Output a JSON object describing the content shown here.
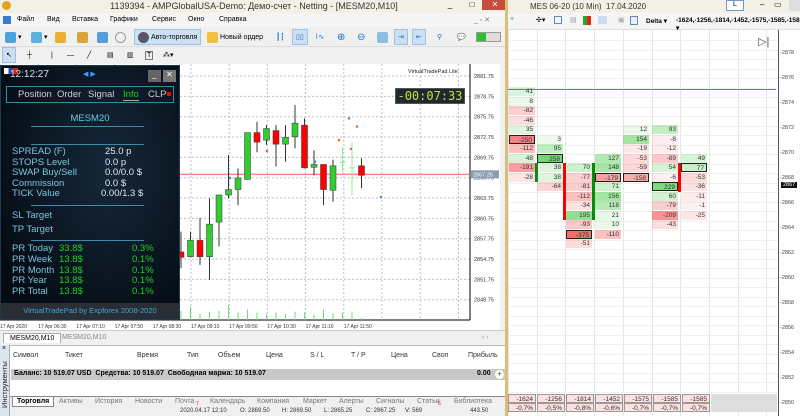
{
  "window": {
    "title": "1139394 - AMPGlobalUSA-Demo: Демо-счет - Netting - [MESM20,M10]",
    "minimize": "_",
    "maximize": "□",
    "close": "✕"
  },
  "menu": [
    "Файл",
    "Вид",
    "Вставка",
    "Графики",
    "Сервис",
    "Окно",
    "Справка"
  ],
  "toolbar": {
    "autotrade": "Авто-торговля",
    "new_order": "Новый ордер",
    "icons": [
      "new-chart-icon",
      "profiles-icon",
      "market-watch-icon",
      "navigator-icon",
      "signals-icon",
      "bar-chart-icon",
      "candles-icon",
      "line-chart-icon",
      "zoom-in-icon",
      "zoom-out-icon",
      "tile-icon",
      "autoscroll-icon",
      "chart-shift-icon",
      "search-icon",
      "chat-icon"
    ]
  },
  "drawing_toolbar": {
    "icons": [
      "cursor-icon",
      "crosshair-icon",
      "vertical-line-icon",
      "horizontal-line-icon",
      "trendline-icon",
      "fibo-icon",
      "label-icon",
      "text-icon",
      "shapes-icon"
    ],
    "text_tool": "T"
  },
  "tradepad": {
    "time": "12:12:27",
    "tabs": [
      "Position",
      "Order",
      "Signal",
      "Info",
      "CLP"
    ],
    "active_tab": "Info",
    "symbol": "MESM20",
    "info": [
      {
        "label": "SPREAD (F)",
        "value": "25.0 p"
      },
      {
        "label": "STOPS Level",
        "value": "0.0 p"
      },
      {
        "label": "SWAP Buy/Sell",
        "value": "0.0/0.0 $"
      },
      {
        "label": "Commission",
        "value": "0.0 $"
      },
      {
        "label": "TICK Value",
        "value": "0.00/1.3 $"
      }
    ],
    "sl_target": "SL Target",
    "tp_target": "TP Target",
    "pr": [
      {
        "label": "PR Today",
        "amount": "33.8$",
        "pct": "0.3%"
      },
      {
        "label": "PR Week",
        "amount": "13.8$",
        "pct": "0.1%"
      },
      {
        "label": "PR Month",
        "amount": "13.8$",
        "pct": "0.1%"
      },
      {
        "label": "PR Year",
        "amount": "13.8$",
        "pct": "0.1%"
      },
      {
        "label": "PR Total",
        "amount": "13.8$",
        "pct": "0.1%"
      }
    ],
    "footer": "VirtualTradePad by Expforex 2008-2020"
  },
  "chart": {
    "indicator_label": "VirtualTradePad Lite",
    "timer": "-00:07:33",
    "current_price": "2867.25",
    "price_ticks": [
      "2881.75",
      "2878.75",
      "2875.75",
      "2872.75",
      "2869.75",
      "2866.75",
      "2863.75",
      "2860.75",
      "2857.75",
      "2854.75",
      "2851.75",
      "2848.75"
    ],
    "time_ticks": [
      "17 Apr 2020",
      "17 Apr 06:30",
      "17 Apr 07:10",
      "17 Apr 07:50",
      "17 Apr 08:30",
      "17 Apr 09:10",
      "17 Apr 09:50",
      "17 Apr 10:30",
      "17 Apr 11:10",
      "17 Apr 11:50"
    ],
    "candles": [
      [
        2855.8,
        2858.8,
        2853.4,
        2855.0
      ],
      [
        2855.1,
        2858.8,
        2855.0,
        2857.5
      ],
      [
        2857.5,
        2860.8,
        2853.9,
        2855.1
      ],
      [
        2855.1,
        2863.7,
        2851.7,
        2859.9
      ],
      [
        2860.2,
        2864.2,
        2856.6,
        2864.2
      ],
      [
        2864.2,
        2870.1,
        2863.7,
        2865.0
      ],
      [
        2865.0,
        2868.1,
        2862.7,
        2866.7
      ],
      [
        2866.5,
        2873.4,
        2866.5,
        2873.4
      ],
      [
        2873.4,
        2875.0,
        2870.5,
        2872.0
      ],
      [
        2872.3,
        2874.5,
        2871.6,
        2874.0
      ],
      [
        2873.7,
        2874.5,
        2868.4,
        2871.7
      ],
      [
        2871.7,
        2874.5,
        2869.1,
        2872.7
      ],
      [
        2872.8,
        2877.5,
        2871.1,
        2874.8
      ],
      [
        2874.5,
        2875.5,
        2868.1,
        2868.2
      ],
      [
        2868.3,
        2870.8,
        2867.1,
        2868.7
      ],
      [
        2868.7,
        2868.7,
        2862.7,
        2865.0
      ],
      [
        2864.9,
        2869.4,
        2863.2,
        2868.5
      ],
      [
        2869.0,
        2871.3,
        2867.6,
        2869.0
      ],
      [
        2868.2,
        2872.1,
        2864.2,
        2868.2
      ],
      [
        2868.5,
        2869.6,
        2865.2,
        2867.1
      ]
    ],
    "volumes": [
      30,
      45,
      20,
      28,
      30,
      50,
      25,
      35,
      25,
      20,
      25,
      20,
      28,
      25,
      18,
      35,
      22,
      25,
      28,
      8
    ],
    "colors": {
      "bull": "#32cd32",
      "bear": "#ff0000",
      "price_line": "#ff5a5a"
    }
  },
  "chart_tabs": [
    "MESM20,M10",
    "MESM20,M10"
  ],
  "terminal": {
    "side_label": "Инструменты",
    "columns": [
      "Символ",
      "Тикет",
      "Время",
      "Тип",
      "Объем",
      "Цена",
      "S / L",
      "T / P",
      "Цена",
      "Своп",
      "Прибыль"
    ],
    "balance_text": "Баланс: 10 519.07 USD  Средства: 10 519.07  Свободная маржа: 10 519.07",
    "profit": "0.00",
    "tabs": [
      "Торговля",
      "Активы",
      "История",
      "Новости",
      "Почта",
      "Календарь",
      "Компания",
      "Маркет",
      "Алерты",
      "Сигналы",
      "Статьи",
      "Библиотека"
    ],
    "active_tab": "Торговля",
    "mail_badge": "7",
    "articles_badge": "6"
  },
  "status": [
    "2020.04.17 12:10",
    "O: 2869.50",
    "H: 2869.50",
    "L: 2865.25",
    "C: 2867.25",
    "V: 569",
    "443.50"
  ],
  "footprint": {
    "title": "MES 06-20 (10 Min)  17.04.2020",
    "button_l": "L",
    "delta": "Delta",
    "totals": [
      "-1624",
      "-1256",
      "-1814",
      "-1452",
      "-1575",
      "-1585",
      "-1585"
    ],
    "price_ticks": [
      "2878",
      "2876",
      "2874",
      "2872",
      "2870",
      "2868",
      "2866",
      "2864",
      "2862",
      "2860",
      "2858",
      "2856",
      "2854",
      "2852",
      "2850"
    ],
    "current_price": "2867",
    "columns": [
      {
        "start": 0,
        "values": [
          41,
          8,
          -82,
          -46,
          35,
          -250,
          -112,
          48,
          -191,
          -28
        ],
        "boxed": 5,
        "bar": "green",
        "bar_rows": [
          8,
          9
        ]
      },
      {
        "start": 5,
        "values": [
          3,
          95,
          258,
          38,
          38,
          -64
        ],
        "boxed": 7,
        "bar": "red",
        "bar_rows": [
          8,
          13
        ]
      },
      {
        "start": 8,
        "values": [
          70,
          -77,
          -81,
          -112,
          -34,
          195,
          -93,
          -375,
          -51
        ],
        "boxed": 15,
        "bar": "green",
        "bar_rows": [
          8,
          13
        ]
      },
      {
        "start": 7,
        "values": [
          127,
          148,
          -179,
          71,
          156,
          118,
          21,
          10,
          -110
        ],
        "boxed": 9
      },
      {
        "start": 4,
        "values": [
          12,
          154,
          -19,
          -53,
          -59,
          -158
        ],
        "boxed": 9
      },
      {
        "start": 4,
        "values": [
          93,
          -8,
          -12,
          -89,
          54,
          -6,
          229,
          60,
          -79,
          -209,
          -43
        ],
        "boxed": 10,
        "bar": "red",
        "bar_rows": [
          8,
          10
        ]
      },
      {
        "start": 7,
        "values": [
          49,
          77,
          -53,
          -36,
          -11,
          -1,
          -25
        ],
        "boxed": 8
      }
    ],
    "totals_pct": [
      "-0,7%",
      "-0,5%",
      "-0,8%",
      "-0,6%",
      "-0,7%",
      "-0,7%",
      "-0,7%"
    ]
  }
}
